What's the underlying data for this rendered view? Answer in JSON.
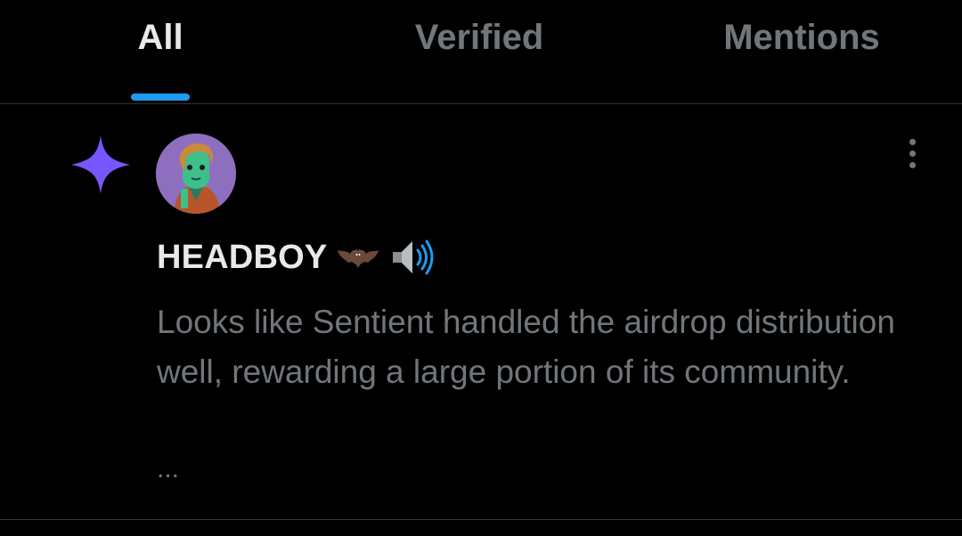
{
  "tabs": {
    "items": [
      {
        "label": "All",
        "active": true
      },
      {
        "label": "Verified",
        "active": false
      },
      {
        "label": "Mentions",
        "active": false
      }
    ]
  },
  "notification": {
    "icon": "sparkle-icon",
    "author": "HEADBOY",
    "author_emoji": [
      "bat-icon",
      "speaker-loud-icon"
    ],
    "text": "Looks like Sentient handled the airdrop distribution well, rewarding a large portion of its community.",
    "truncation": "...",
    "more_icon": "more-vertical-icon"
  },
  "colors": {
    "background": "#000000",
    "accent": "#1d9bf0",
    "sparkle": "#7856ff",
    "text_primary": "#e7e9ea",
    "text_secondary": "#71767b",
    "divider": "#2f3336"
  }
}
